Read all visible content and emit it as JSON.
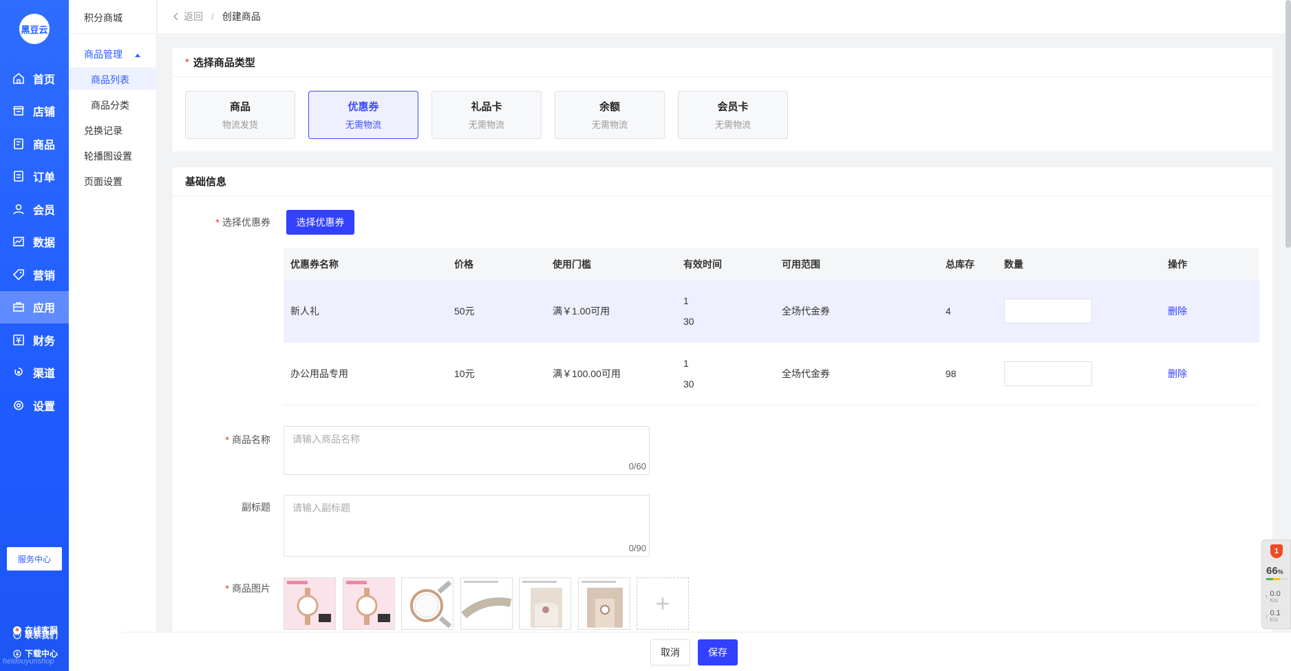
{
  "brand": {
    "logo_text": "黑豆云",
    "watermark": "heidouyunshop"
  },
  "nav": [
    {
      "label": "首页",
      "icon": "home-icon",
      "active": false
    },
    {
      "label": "店铺",
      "icon": "store-icon",
      "active": false
    },
    {
      "label": "商品",
      "icon": "goods-icon",
      "active": false
    },
    {
      "label": "订单",
      "icon": "order-icon",
      "active": false
    },
    {
      "label": "会员",
      "icon": "member-icon",
      "active": false
    },
    {
      "label": "数据",
      "icon": "chart-icon",
      "active": false
    },
    {
      "label": "营销",
      "icon": "tag-icon",
      "active": false
    },
    {
      "label": "应用",
      "icon": "app-icon",
      "active": true
    },
    {
      "label": "财务",
      "icon": "finance-icon",
      "active": false
    },
    {
      "label": "渠道",
      "icon": "channel-icon",
      "active": false
    },
    {
      "label": "设置",
      "icon": "gear-icon",
      "active": false
    }
  ],
  "service": {
    "center": "服务中心",
    "online": "在线客服",
    "download": "下载中心",
    "contact": "联系我们"
  },
  "subnav": {
    "title": "积分商城",
    "group": "商品管理",
    "list": "商品列表",
    "category": "商品分类",
    "exchange": "兑换记录",
    "carousel": "轮播图设置",
    "page": "页面设置"
  },
  "breadcrumb": {
    "back": "返回",
    "separator": "/",
    "current": "创建商品"
  },
  "type_section": {
    "title": "选择商品类型",
    "types": [
      {
        "title": "商品",
        "sub": "物流发货",
        "selected": false
      },
      {
        "title": "优惠券",
        "sub": "无需物流",
        "selected": true
      },
      {
        "title": "礼品卡",
        "sub": "无需物流",
        "selected": false
      },
      {
        "title": "余额",
        "sub": "无需物流",
        "selected": false
      },
      {
        "title": "会员卡",
        "sub": "无需物流",
        "selected": false
      }
    ]
  },
  "basic": {
    "title": "基础信息",
    "coupon_label": "选择优惠券",
    "coupon_button": "选择优惠券",
    "table": {
      "headers": [
        "优惠券名称",
        "价格",
        "使用门槛",
        "有效时间",
        "可用范围",
        "总库存",
        "数量",
        "操作"
      ],
      "rows": [
        {
          "name": "新人礼",
          "price": "50元",
          "threshold": "满￥1.00可用",
          "valid_from": "1",
          "valid_to": "30",
          "scope": "全场代金券",
          "stock": "4",
          "qty": "",
          "action": "删除",
          "highlight": true
        },
        {
          "name": "办公用品专用",
          "price": "10元",
          "threshold": "满￥100.00可用",
          "valid_from": "1",
          "valid_to": "30",
          "scope": "全场代金券",
          "stock": "98",
          "qty": "",
          "action": "删除",
          "highlight": false
        }
      ]
    },
    "name_label": "商品名称",
    "name_placeholder": "请输入商品名称",
    "name_count": "0/60",
    "subtitle_label": "副标题",
    "subtitle_placeholder": "请输入副标题",
    "subtitle_count": "0/90",
    "image_label": "商品图片",
    "images": [
      "watch-image-1",
      "watch-image-2",
      "watch-image-3",
      "watch-image-4",
      "watch-image-5",
      "watch-image-6"
    ],
    "add_image": "+"
  },
  "actions": {
    "cancel": "取消",
    "save": "保存"
  },
  "widget": {
    "badge": "1",
    "percent": "66",
    "percent_unit": "%",
    "up": "0.0",
    "down": "0.1",
    "unit": "K/s"
  },
  "colors": {
    "primary": "#3340ff",
    "sidebar": "#1f5bff",
    "required": "#f5222d"
  }
}
